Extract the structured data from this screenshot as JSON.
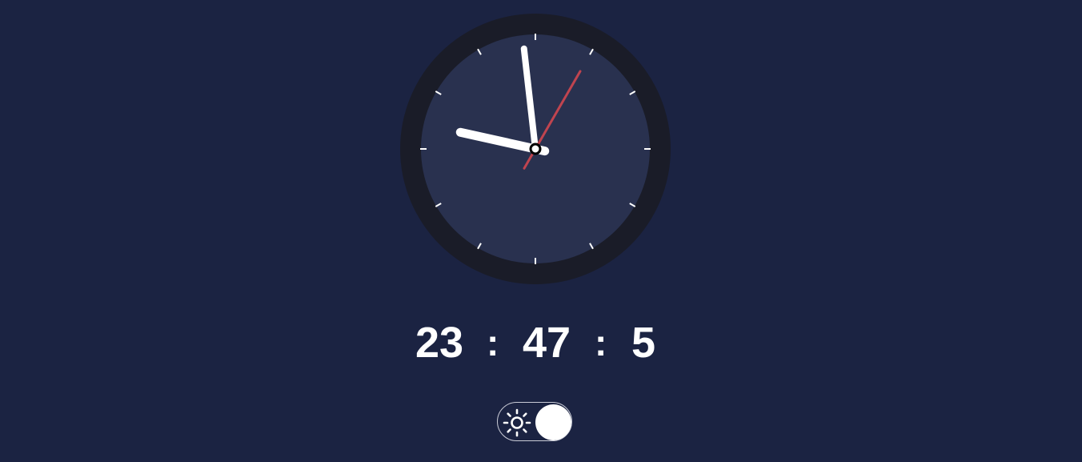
{
  "clock": {
    "hours": 23,
    "minutes": 47,
    "seconds": 5
  },
  "digital": {
    "hours": "23",
    "separator": ":",
    "minutes": "47",
    "seconds": "5"
  },
  "theme_toggle": {
    "icon": "sun-icon",
    "state": "dark"
  },
  "colors": {
    "background": "#1b2342",
    "bezel": "#1a1c28",
    "face": "#29314f",
    "hands": "#ffffff",
    "second_hand": "#c0444f"
  }
}
